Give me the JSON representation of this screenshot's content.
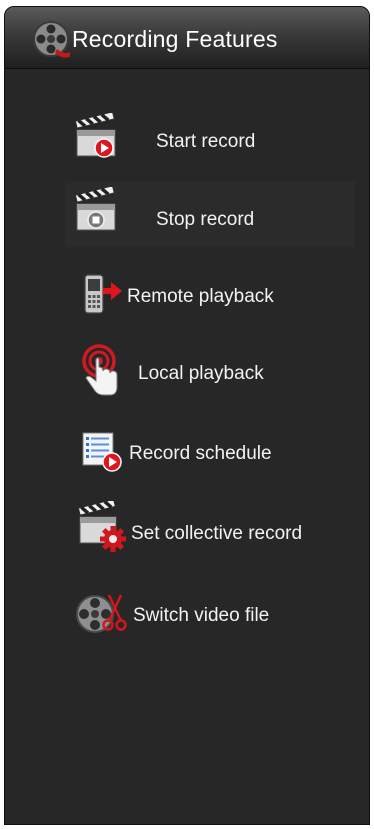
{
  "header": {
    "title": "Recording Features",
    "icon": "film-reel-icon"
  },
  "menu": {
    "items": [
      {
        "label": "Start record",
        "icon": "clapperboard-record-icon"
      },
      {
        "label": "Stop record",
        "icon": "clapperboard-stop-icon"
      },
      {
        "label": "Remote playback",
        "icon": "remote-device-playback-icon"
      },
      {
        "label": "Local playback",
        "icon": "touch-hand-icon"
      },
      {
        "label": "Record schedule",
        "icon": "schedule-list-record-icon"
      },
      {
        "label": "Set collective record",
        "icon": "clapperboard-gear-icon"
      },
      {
        "label": "Switch video file",
        "icon": "film-reel-scissors-icon"
      }
    ]
  },
  "colors": {
    "panel_background": "#272727",
    "accent_red": "#e0161e",
    "text": "#f2f2f2"
  }
}
